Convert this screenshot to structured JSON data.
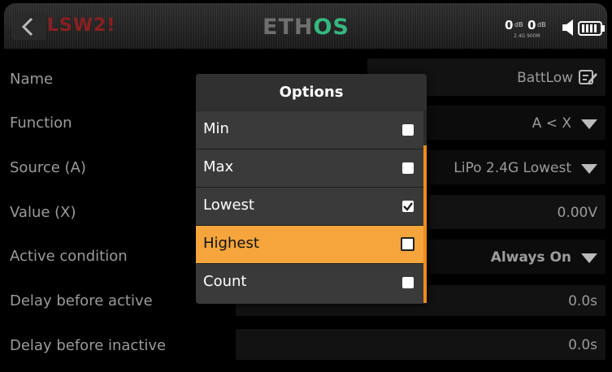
{
  "header": {
    "back_icon": "chevron-left-icon",
    "title": "LSW2!",
    "logo_part1": "ETH",
    "logo_part2": "OS",
    "rf": {
      "val1": "0",
      "unit1": "dB",
      "val2": "0",
      "unit2": "dB",
      "sub": "2.4G 900M"
    },
    "speaker_icon": "speaker-icon",
    "battery_icon": "battery-icon"
  },
  "rows": [
    {
      "label": "Name",
      "value": "BattLow",
      "icon": "edit-icon"
    },
    {
      "label": "Function",
      "value": "A < X",
      "icon": "dropdown-arrow-icon"
    },
    {
      "label": "Source (A)",
      "value": "LiPo 2.4G Lowest",
      "icon": "dropdown-arrow-icon"
    },
    {
      "label": "Value (X)",
      "value": "0.00V"
    },
    {
      "label": "Active condition",
      "value": "Always On",
      "icon": "dropdown-arrow-icon"
    },
    {
      "label": "Delay before active",
      "value": "0.0s"
    },
    {
      "label": "Delay before inactive",
      "value": "0.0s"
    }
  ],
  "dialog": {
    "title": "Options",
    "options": [
      {
        "label": "Min",
        "checked": false
      },
      {
        "label": "Max",
        "checked": false
      },
      {
        "label": "Lowest",
        "checked": true
      },
      {
        "label": "Highest",
        "checked": false,
        "selected": true
      },
      {
        "label": "Count",
        "checked": false
      }
    ]
  },
  "colors": {
    "accent": "#f5a53b",
    "scrollbar": "#f08b1e",
    "title_red": "#8a1f1f",
    "logo_green": "#35b77f"
  }
}
